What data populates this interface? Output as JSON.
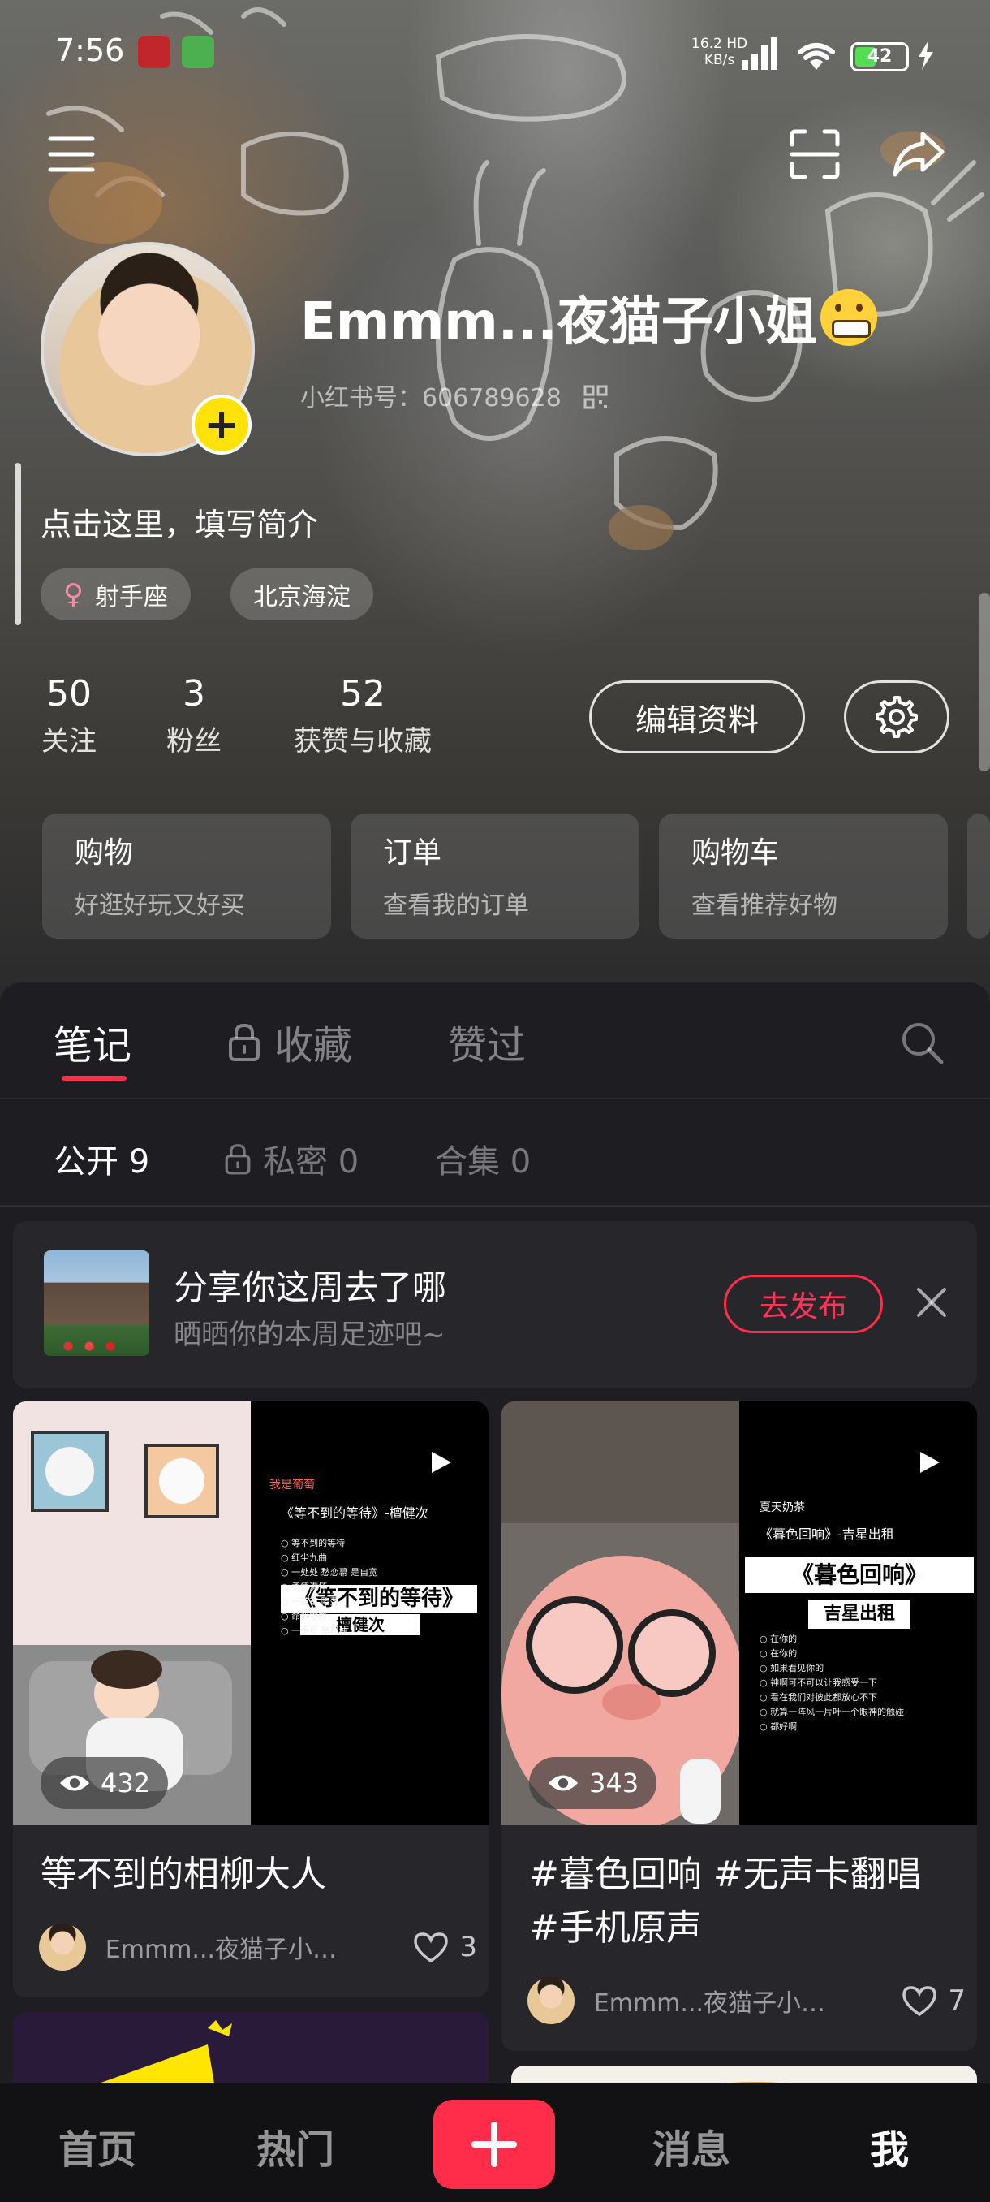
{
  "status_bar": {
    "time": "7:56",
    "net_speed_value": "16.2",
    "net_speed_hd": "HD",
    "net_speed_unit": "KB/s",
    "battery_text": "42",
    "battery_level": 0.42
  },
  "profile": {
    "username": "Emmm...夜猫子小姐",
    "red_id": "小红书号：606789628",
    "bio": "点击这里，填写简介",
    "tags": [
      {
        "label": "射手座",
        "symbol": "♀"
      },
      {
        "label": "北京海淀"
      }
    ]
  },
  "stats": [
    {
      "value": "50",
      "label": "关注"
    },
    {
      "value": "3",
      "label": "粉丝"
    },
    {
      "value": "52",
      "label": "获赞与收藏"
    }
  ],
  "actions": {
    "edit_profile": "编辑资料"
  },
  "shortcuts": [
    {
      "title": "购物",
      "subtitle": "好逛好玩又好买"
    },
    {
      "title": "订单",
      "subtitle": "查看我的订单"
    },
    {
      "title": "购物车",
      "subtitle": "查看推荐好物"
    }
  ],
  "tabs": [
    {
      "label": "笔记",
      "active": true
    },
    {
      "label": "收藏",
      "locked": true
    },
    {
      "label": "赞过"
    }
  ],
  "subtabs": [
    {
      "label": "公开 9",
      "active": true
    },
    {
      "label": "私密 0",
      "locked": true
    },
    {
      "label": "合集 0"
    }
  ],
  "promo": {
    "title": "分享你这周去了哪",
    "subtitle": "晒晒你的本周足迹吧~",
    "button": "去发布"
  },
  "notes": [
    {
      "title": "等不到的相柳大人",
      "views": "432",
      "author": "Emmm...夜猫子小…",
      "likes": "3",
      "image_text": {
        "back": "我是葡萄",
        "heading": "《等不到的等待》-檀健次",
        "lines": [
          "等不到的等待",
          "红尘九曲",
          "一处处 愁恋幕 是自宽",
          "柔情满怀",
          "一首首 陷落",
          "命似雪舞",
          "一步步 是孤独"
        ],
        "big1": "《等不到的等待》",
        "big2": "檀健次"
      }
    },
    {
      "title": "#暮色回响 #无声卡翻唱 #手机原声",
      "views": "343",
      "author": "Emmm...夜猫子小…",
      "likes": "7",
      "image_text": {
        "back": "夏天奶茶",
        "heading": "《暮色回响》-吉星出租",
        "big1": "《暮色回响》",
        "big2": "吉星出租",
        "lines": [
          "在你的",
          "在你的",
          "如果看见你的",
          "神啊可不可以让我感受一下",
          "看在我们对彼此都放心不下",
          "就算一阵风一片叶一个眼神的触碰",
          "都好啊"
        ]
      }
    }
  ],
  "bottom_nav": [
    {
      "label": "首页"
    },
    {
      "label": "热门"
    },
    {
      "label": "消息"
    },
    {
      "label": "我",
      "active": true
    }
  ],
  "colors": {
    "accent": "#ff2d4a",
    "badge_yellow": "#ffe20a",
    "battery_green": "#52e052"
  },
  "icons": [
    "menu-icon",
    "scan-icon",
    "share-icon",
    "qr-code-icon",
    "add-icon",
    "gear-icon",
    "lock-icon",
    "search-icon",
    "close-icon",
    "eye-icon",
    "play-icon",
    "heart-icon",
    "plus-icon"
  ]
}
